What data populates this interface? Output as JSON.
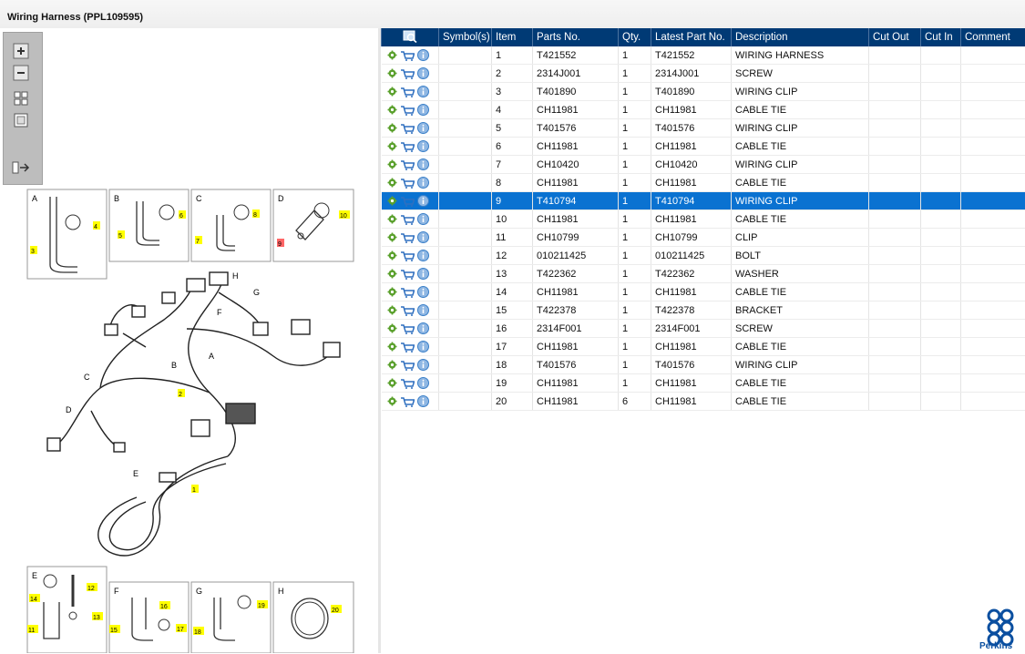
{
  "title": "Wiring Harness (PPL109595)",
  "table": {
    "headers": [
      "",
      "Symbol(s)",
      "Item",
      "Parts No.",
      "Qty.",
      "Latest Part No.",
      "Description",
      "Cut Out",
      "Cut In",
      "Comment"
    ],
    "selected_item": "9",
    "rows": [
      {
        "item": "1",
        "parts_no": "T421552",
        "qty": "1",
        "latest": "T421552",
        "desc": "WIRING HARNESS"
      },
      {
        "item": "2",
        "parts_no": "2314J001",
        "qty": "1",
        "latest": "2314J001",
        "desc": "SCREW"
      },
      {
        "item": "3",
        "parts_no": "T401890",
        "qty": "1",
        "latest": "T401890",
        "desc": "WIRING CLIP"
      },
      {
        "item": "4",
        "parts_no": "CH11981",
        "qty": "1",
        "latest": "CH11981",
        "desc": "CABLE TIE"
      },
      {
        "item": "5",
        "parts_no": "T401576",
        "qty": "1",
        "latest": "T401576",
        "desc": "WIRING CLIP"
      },
      {
        "item": "6",
        "parts_no": "CH11981",
        "qty": "1",
        "latest": "CH11981",
        "desc": "CABLE TIE"
      },
      {
        "item": "7",
        "parts_no": "CH10420",
        "qty": "1",
        "latest": "CH10420",
        "desc": "WIRING CLIP"
      },
      {
        "item": "8",
        "parts_no": "CH11981",
        "qty": "1",
        "latest": "CH11981",
        "desc": "CABLE TIE"
      },
      {
        "item": "9",
        "parts_no": "T410794",
        "qty": "1",
        "latest": "T410794",
        "desc": "WIRING CLIP"
      },
      {
        "item": "10",
        "parts_no": "CH11981",
        "qty": "1",
        "latest": "CH11981",
        "desc": "CABLE TIE"
      },
      {
        "item": "11",
        "parts_no": "CH10799",
        "qty": "1",
        "latest": "CH10799",
        "desc": "CLIP"
      },
      {
        "item": "12",
        "parts_no": "010211425",
        "qty": "1",
        "latest": "010211425",
        "desc": "BOLT"
      },
      {
        "item": "13",
        "parts_no": "T422362",
        "qty": "1",
        "latest": "T422362",
        "desc": "WASHER"
      },
      {
        "item": "14",
        "parts_no": "CH11981",
        "qty": "1",
        "latest": "CH11981",
        "desc": "CABLE TIE"
      },
      {
        "item": "15",
        "parts_no": "T422378",
        "qty": "1",
        "latest": "T422378",
        "desc": "BRACKET"
      },
      {
        "item": "16",
        "parts_no": "2314F001",
        "qty": "1",
        "latest": "2314F001",
        "desc": "SCREW"
      },
      {
        "item": "17",
        "parts_no": "CH11981",
        "qty": "1",
        "latest": "CH11981",
        "desc": "CABLE TIE"
      },
      {
        "item": "18",
        "parts_no": "T401576",
        "qty": "1",
        "latest": "T401576",
        "desc": "WIRING CLIP"
      },
      {
        "item": "19",
        "parts_no": "CH11981",
        "qty": "1",
        "latest": "CH11981",
        "desc": "CABLE TIE"
      },
      {
        "item": "20",
        "parts_no": "CH11981",
        "qty": "6",
        "latest": "CH11981",
        "desc": "CABLE TIE"
      }
    ]
  },
  "toolbar": {
    "icons": [
      "zoom-in-icon",
      "zoom-out-icon",
      "fit-page-icon",
      "actual-size-icon",
      "toggle-panel-icon"
    ]
  },
  "diagram": {
    "detail_boxes_top": [
      {
        "letter": "A",
        "callouts": [
          "3",
          "4"
        ]
      },
      {
        "letter": "B",
        "callouts": [
          "5",
          "6"
        ]
      },
      {
        "letter": "C",
        "callouts": [
          "7",
          "8"
        ]
      },
      {
        "letter": "D",
        "callouts": [
          "9",
          "10"
        ]
      }
    ],
    "detail_boxes_bottom": [
      {
        "letter": "E",
        "callouts": [
          "14",
          "12",
          "11",
          "13"
        ]
      },
      {
        "letter": "F",
        "callouts": [
          "16",
          "15",
          "17"
        ]
      },
      {
        "letter": "G",
        "callouts": [
          "19",
          "18"
        ]
      },
      {
        "letter": "H",
        "callouts": [
          "20"
        ]
      }
    ],
    "main_letters": [
      "H",
      "G",
      "F",
      "A",
      "B",
      "C",
      "D",
      "E"
    ],
    "main_callouts": [
      "2",
      "1"
    ],
    "highlight_callout": "9"
  },
  "logo": {
    "text": "Perkins"
  },
  "colors": {
    "header": "#003a75",
    "selected": "#0a72d1",
    "callout": "#ffff00",
    "callout_highlight": "#ff6666",
    "gear": "#5aa02c",
    "info": "#3a7fc8"
  }
}
